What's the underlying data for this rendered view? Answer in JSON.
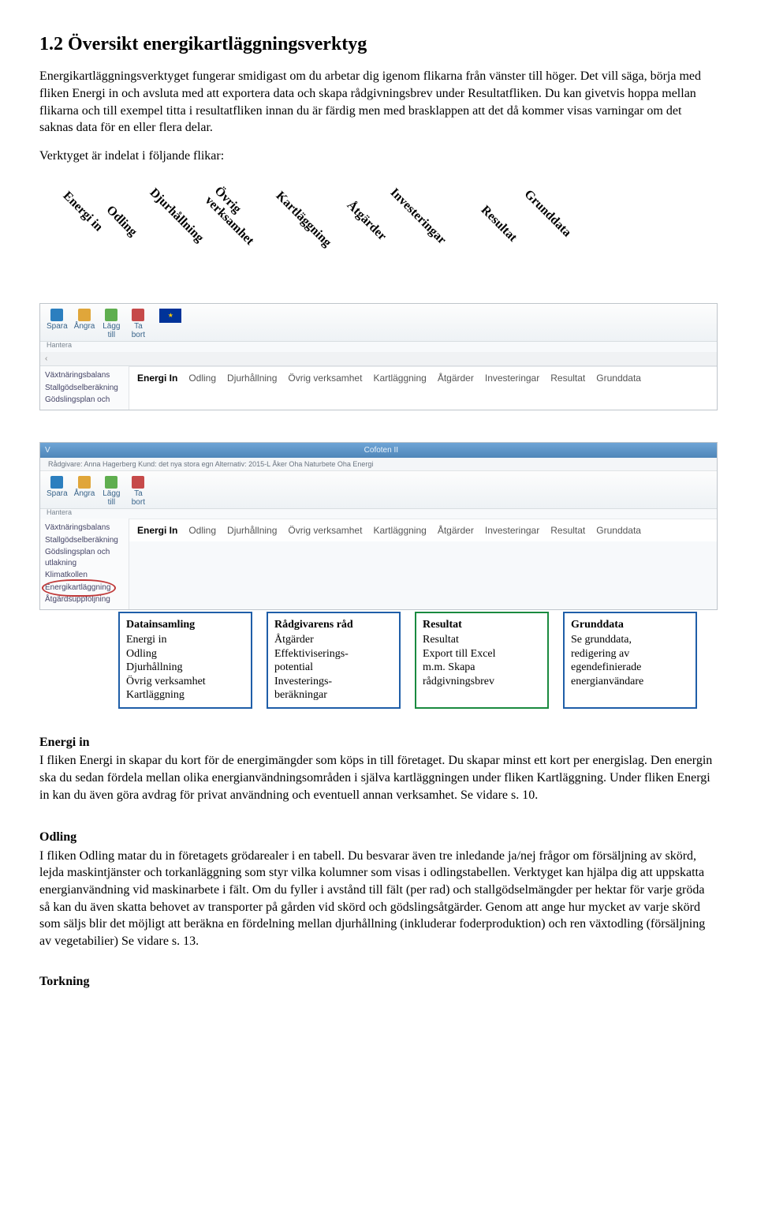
{
  "heading": "1.2 Översikt energikartläggningsverktyg",
  "intro_p1": "Energikartläggningsverktyget fungerar smidigast om du arbetar dig igenom flikarna från vänster till höger. Det vill säga, börja med fliken Energi in och avsluta med att exportera data och skapa rådgivningsbrev under Resultatfliken. Du kan givetvis hoppa mellan flikarna och till exempel titta i resultatfliken innan du är färdig men med brasklappen att det då kommer visas varningar om det saknas data för en eller flera delar.",
  "intro_p2": "Verktyget är indelat i följande flikar:",
  "diag_labels": [
    "Energi in",
    "Odling",
    "Djurhållning",
    "Övrig verksamhet",
    "Kartläggning",
    "Åtgärder",
    "Investeringar",
    "Resultat",
    "Grunddata"
  ],
  "ribbon": {
    "spara": "Spara",
    "angra": "Ångra",
    "lagg_till": "Lägg\ntill",
    "ta_bort": "Ta\nbort",
    "hantera": "Hantera"
  },
  "sidebar": {
    "items": [
      "Växtnäringsbalans",
      "Stallgödselberäkning",
      "Gödslingsplan och"
    ]
  },
  "sidebar2": {
    "items": [
      "Växtnäringsbalans",
      "Stallgödselberäkning",
      "Gödslingsplan och utlakning",
      "Klimatkollen",
      "Energikartläggning",
      "Åtgärdsuppföljning"
    ]
  },
  "tabs": [
    "Energi In",
    "Odling",
    "Djurhållning",
    "Övrig verksamhet",
    "Kartläggning",
    "Åtgärder",
    "Investeringar",
    "Resultat",
    "Grunddata"
  ],
  "titlebar": {
    "left": "V",
    "center": "Cofoten II"
  },
  "crumb": "Rådgivare: Anna Hagerberg  Kund: det nya stora egn  Alternativ: 2015-L Åker Oha Naturbete Oha    Energi",
  "boxes": {
    "b1": {
      "title": "Datainsamling",
      "lines": [
        "Energi in",
        "Odling",
        "Djurhållning",
        "Övrig verksamhet",
        "Kartläggning"
      ]
    },
    "b2": {
      "title": "Rådgivarens råd",
      "lines": [
        "Åtgärder",
        "Effektiviserings-",
        "potential",
        "Investerings-",
        "beräkningar"
      ]
    },
    "b3": {
      "title": "Resultat",
      "lines": [
        "Resultat",
        "Export till Excel",
        "m.m. Skapa",
        "rådgivningsbrev"
      ]
    },
    "b4": {
      "title": "Grunddata",
      "lines": [
        "Se grunddata,",
        "redigering av",
        "egendefinierade",
        "energianvändare"
      ]
    }
  },
  "sections": {
    "energi_in": {
      "title": "Energi in",
      "text": "I fliken Energi in skapar du kort för de energimängder som köps in till företaget. Du skapar minst ett kort per energislag. Den energin ska du sedan fördela mellan olika energianvändningsområden i själva kartläggningen under fliken Kartläggning. Under fliken Energi in kan du även göra avdrag för privat användning och eventuell annan verksamhet. Se vidare s. 10."
    },
    "odling": {
      "title": "Odling",
      "text": "I fliken Odling matar du in företagets grödarealer i en tabell. Du besvarar även tre inledande ja/nej frågor om försäljning av skörd, lejda maskintjänster och torkanläggning som styr vilka kolumner som visas i odlingstabellen. Verktyget kan hjälpa dig att uppskatta energianvändning vid maskinarbete i fält. Om du fyller i avstånd till fält (per rad) och stallgödselmängder per hektar för varje gröda så kan du även skatta behovet av transporter på gården vid skörd och gödslingsåtgärder. Genom att ange hur mycket av varje skörd som säljs blir det möjligt att beräkna en fördelning mellan djurhållning (inkluderar foderproduktion) och ren växtodling (försäljning av vegetabilier) Se vidare s. 13."
    },
    "torkning": "Torkning"
  }
}
